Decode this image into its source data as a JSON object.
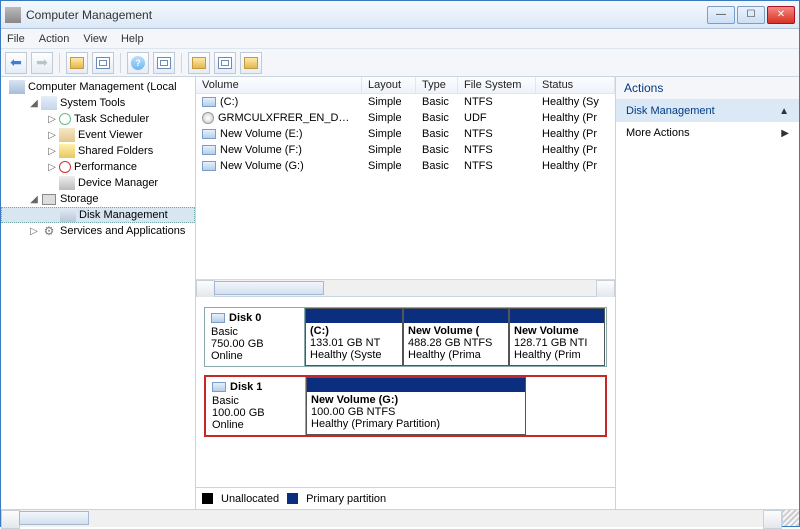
{
  "window": {
    "title": "Computer Management"
  },
  "menubar": [
    "File",
    "Action",
    "View",
    "Help"
  ],
  "tree": {
    "root": "Computer Management (Local",
    "sys": "System Tools",
    "task": "Task Scheduler",
    "event": "Event Viewer",
    "shared": "Shared Folders",
    "perf": "Performance",
    "dev": "Device Manager",
    "storage": "Storage",
    "disk": "Disk Management",
    "svc": "Services and Applications"
  },
  "volcols": {
    "volume": "Volume",
    "layout": "Layout",
    "type": "Type",
    "fs": "File System",
    "status": "Status"
  },
  "volumes": [
    {
      "name": "(C:)",
      "icon": "drive",
      "layout": "Simple",
      "type": "Basic",
      "fs": "NTFS",
      "status": "Healthy (Sy"
    },
    {
      "name": "GRMCULXFRER_EN_DVD (D:)",
      "icon": "cd",
      "layout": "Simple",
      "type": "Basic",
      "fs": "UDF",
      "status": "Healthy (Pr"
    },
    {
      "name": "New Volume (E:)",
      "icon": "drive",
      "layout": "Simple",
      "type": "Basic",
      "fs": "NTFS",
      "status": "Healthy (Pr"
    },
    {
      "name": "New Volume (F:)",
      "icon": "drive",
      "layout": "Simple",
      "type": "Basic",
      "fs": "NTFS",
      "status": "Healthy (Pr"
    },
    {
      "name": "New Volume (G:)",
      "icon": "drive",
      "layout": "Simple",
      "type": "Basic",
      "fs": "NTFS",
      "status": "Healthy (Pr"
    }
  ],
  "disk0": {
    "label": "Disk 0",
    "type": "Basic",
    "size": "750.00 GB",
    "state": "Online",
    "parts": [
      {
        "name": "(C:)",
        "size": "133.01 GB NT",
        "status": "Healthy (Syste"
      },
      {
        "name": "New Volume (",
        "size": "488.28 GB NTFS",
        "status": "Healthy (Prima"
      },
      {
        "name": "New Volume",
        "size": "128.71 GB NTI",
        "status": "Healthy (Prim"
      }
    ]
  },
  "disk1": {
    "label": "Disk 1",
    "type": "Basic",
    "size": "100.00 GB",
    "state": "Online",
    "part": {
      "name": "New Volume  (G:)",
      "size": "100.00 GB NTFS",
      "status": "Healthy (Primary Partition)"
    }
  },
  "legend": {
    "unalloc": "Unallocated",
    "primary": "Primary partition"
  },
  "actions": {
    "title": "Actions",
    "head": "Disk Management",
    "more": "More Actions"
  }
}
